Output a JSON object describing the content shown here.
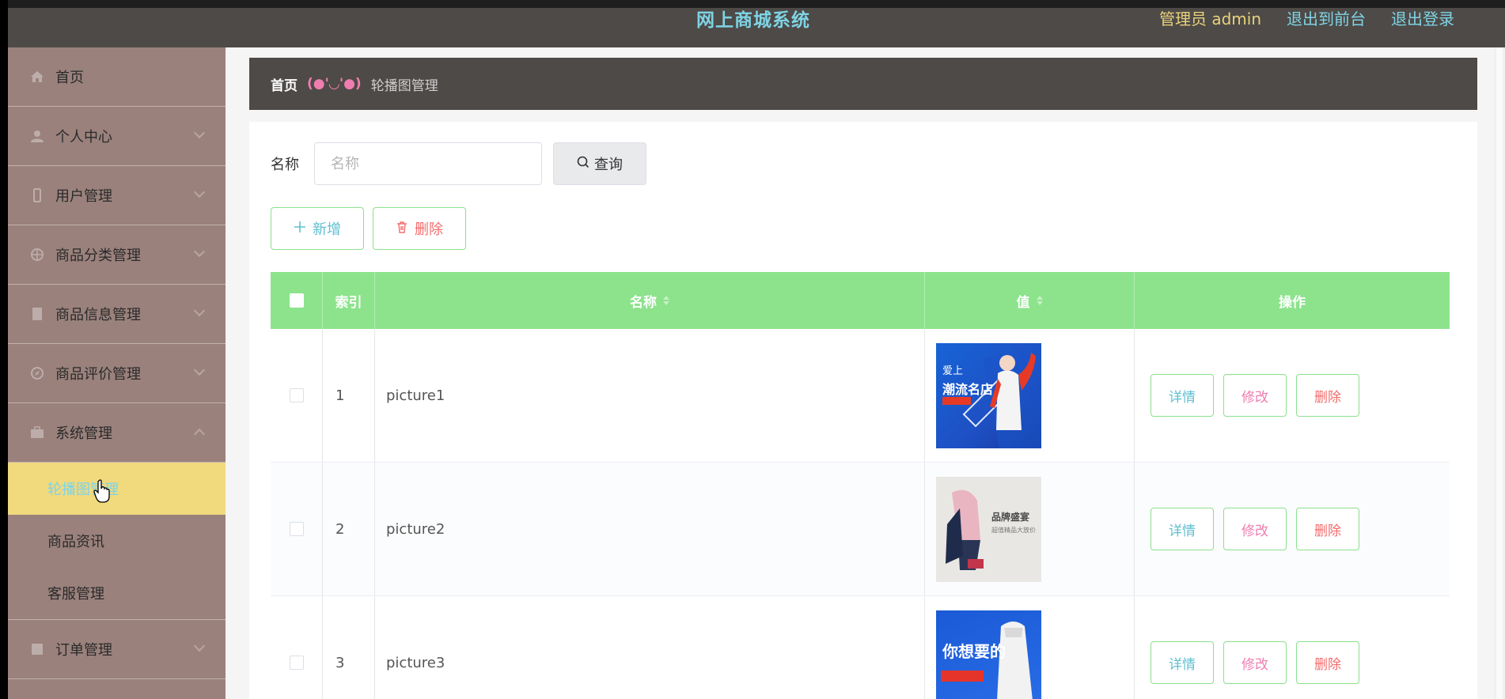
{
  "header": {
    "title": "网上商城系统",
    "admin": "管理员 admin",
    "back_front": "退出到前台",
    "logout": "退出登录"
  },
  "sidebar": {
    "items": [
      {
        "label": "首页"
      },
      {
        "label": "个人中心"
      },
      {
        "label": "用户管理"
      },
      {
        "label": "商品分类管理"
      },
      {
        "label": "商品信息管理"
      },
      {
        "label": "商品评价管理"
      },
      {
        "label": "系统管理"
      },
      {
        "label": "订单管理"
      }
    ],
    "sub_items": [
      {
        "label": "轮播图管理"
      },
      {
        "label": "商品资讯"
      },
      {
        "label": "客服管理"
      }
    ]
  },
  "breadcrumb": {
    "home": "首页",
    "face": "(●'◡'●)",
    "current": "轮播图管理"
  },
  "search": {
    "label": "名称",
    "placeholder": "名称",
    "query_label": "查询"
  },
  "actions": {
    "add_label": "新增",
    "delete_label": "删除"
  },
  "table": {
    "columns": [
      "索引",
      "名称",
      "值",
      "操作"
    ],
    "rows": [
      {
        "index": "1",
        "name": "picture1",
        "thumb_text": [
          "爱上",
          "潮流名店"
        ]
      },
      {
        "index": "2",
        "name": "picture2",
        "thumb_text": [
          "品牌盛宴",
          "超值精品大放价"
        ]
      },
      {
        "index": "3",
        "name": "picture3",
        "thumb_text": [
          "你想要的"
        ]
      }
    ],
    "ops": {
      "detail": "详情",
      "edit": "修改",
      "remove": "删除"
    }
  },
  "colors": {
    "header_bg": "#4e4a47",
    "sidebar_bg": "#9a817c",
    "active_bg": "#f1d97e",
    "table_header": "#8ce38c",
    "accent_cyan": "#7ed4e6"
  }
}
